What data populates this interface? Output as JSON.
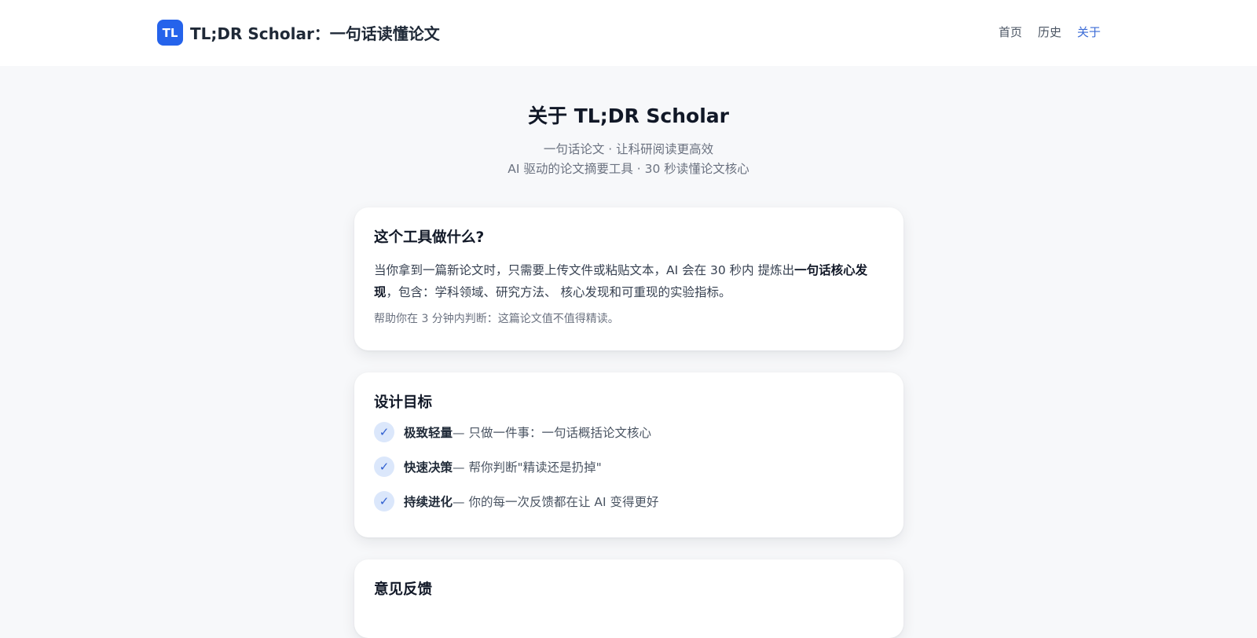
{
  "header": {
    "logo_text": "TL",
    "title": "TL;DR Scholar：一句话读懂论文",
    "nav": [
      {
        "label": "首页",
        "active": false
      },
      {
        "label": "历史",
        "active": false
      },
      {
        "label": "关于",
        "active": true
      }
    ]
  },
  "hero": {
    "title": "关于 TL;DR Scholar",
    "subtitle_1": "一句话论文 · 让科研阅读更高效",
    "subtitle_2": "AI 驱动的论文摘要工具 · 30 秒读懂论文核心"
  },
  "what": {
    "heading": "这个工具做什么?",
    "text_before": "当你拿到一篇新论文时，只需要上传文件或粘贴文本，AI 会在 30 秒内 提炼出",
    "text_bold": "一句话核心发现",
    "text_after": "，包含：学科领域、研究方法、 核心发现和可重现的实验指标。",
    "note": "帮助你在 3 分钟内判断：这篇论文值不值得精读。"
  },
  "goals": {
    "heading": "设计目标",
    "items": [
      {
        "title": "极致轻量",
        "desc": " — 只做一件事：一句话概括论文核心"
      },
      {
        "title": "快速决策",
        "desc": " — 帮你判断\"精读还是扔掉\""
      },
      {
        "title": "持续进化",
        "desc": " — 你的每一次反馈都在让 AI 变得更好"
      }
    ],
    "check_glyph": "✓"
  },
  "feedback": {
    "heading": "意见反馈"
  },
  "colors": {
    "accent": "#2563eb",
    "nav_active": "#3b6bd6",
    "page_bg": "#f7f8fa",
    "check_bg": "#dbe7fb"
  }
}
